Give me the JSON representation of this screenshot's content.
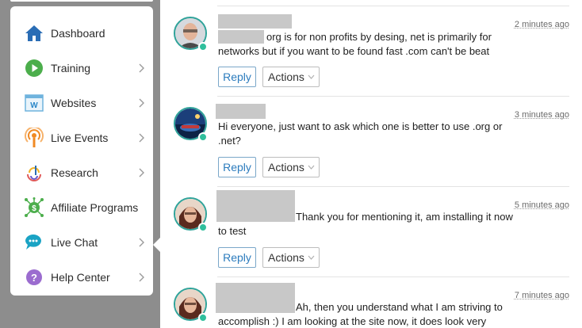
{
  "sidebar": {
    "items": [
      {
        "label": "Dashboard",
        "icon": "home-icon",
        "has_chevron": false
      },
      {
        "label": "Training",
        "icon": "play-icon",
        "has_chevron": true
      },
      {
        "label": "Websites",
        "icon": "website-icon",
        "has_chevron": true
      },
      {
        "label": "Live Events",
        "icon": "broadcast-icon",
        "has_chevron": true
      },
      {
        "label": "Research",
        "icon": "research-icon",
        "has_chevron": true
      },
      {
        "label": "Affiliate Programs",
        "icon": "money-network-icon",
        "has_chevron": false
      },
      {
        "label": "Live Chat",
        "icon": "chat-icon",
        "has_chevron": true
      },
      {
        "label": "Help Center",
        "icon": "help-icon",
        "has_chevron": true
      }
    ]
  },
  "feed": {
    "posts": [
      {
        "time": "2 minutes ago",
        "text": "org is for non profits by desing, net is primarily for networks but if you want to be found fast .com can't be beat",
        "reply": "Reply",
        "actions": "Actions"
      },
      {
        "time": "3 minutes ago",
        "text": "Hi everyone, just want to ask which one is better to use .org or .net?",
        "reply": "Reply",
        "actions": "Actions"
      },
      {
        "time": "5 minutes ago",
        "text": "Thank you for mentioning it, am installing it now to test",
        "reply": "Reply",
        "actions": "Actions"
      },
      {
        "time": "7 minutes ago",
        "text": "Ah, then you understand what I am striving to accomplish :) I am looking at the site now, it does look very promising",
        "reply": "Reply",
        "actions": "Actions"
      }
    ]
  },
  "colors": {
    "accent": "#2b7bbd",
    "avatar_ring": "#2fa39a",
    "online_badge": "#2fbf9c",
    "redaction": "#c8c8c8"
  }
}
